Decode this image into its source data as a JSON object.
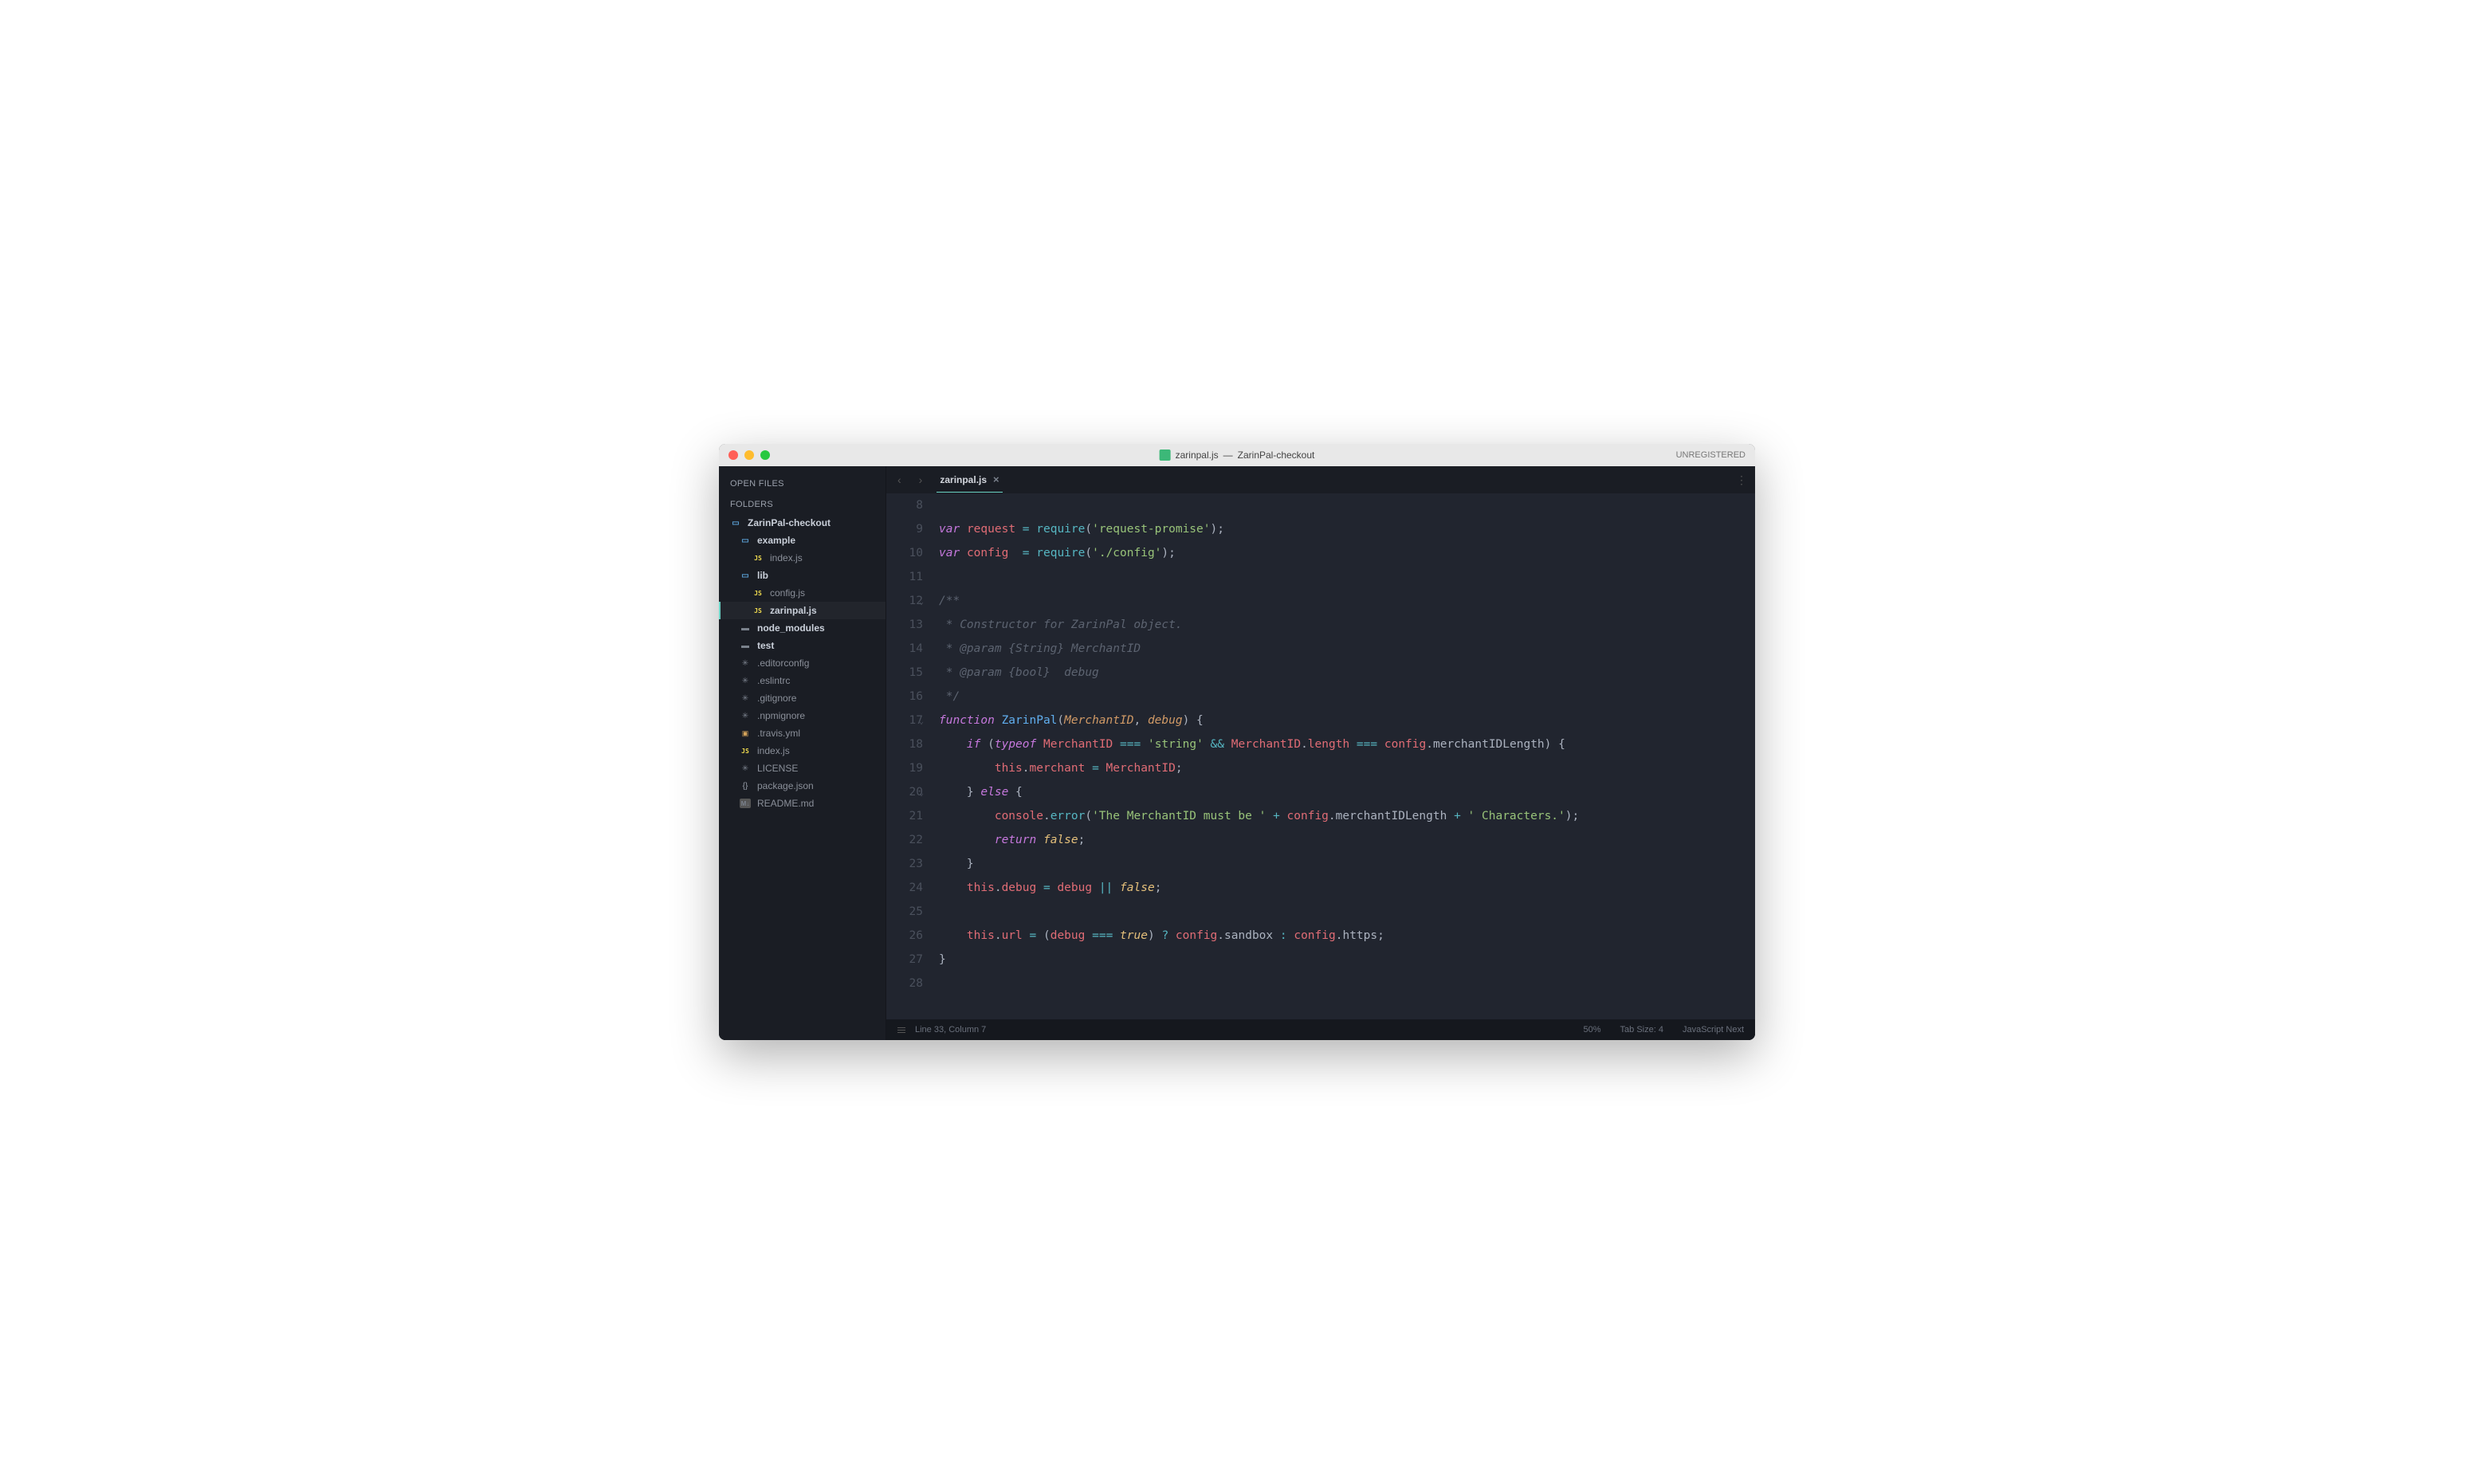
{
  "titlebar": {
    "filename": "zarinpal.js",
    "project": "ZarinPal-checkout",
    "separator": " — ",
    "unregistered": "UNREGISTERED"
  },
  "sidebar": {
    "open_files_label": "OPEN FILES",
    "folders_label": "FOLDERS",
    "tree": [
      {
        "label": "ZarinPal-checkout",
        "icon": "folder-open",
        "indent": 0,
        "bold": true
      },
      {
        "label": "example",
        "icon": "folder-open",
        "indent": 1,
        "bold": true
      },
      {
        "label": "index.js",
        "icon": "js",
        "indent": 2
      },
      {
        "label": "lib",
        "icon": "folder-open",
        "indent": 1,
        "bold": true
      },
      {
        "label": "config.js",
        "icon": "js",
        "indent": 2
      },
      {
        "label": "zarinpal.js",
        "icon": "js",
        "indent": 2,
        "bold": true,
        "active": true
      },
      {
        "label": "node_modules",
        "icon": "folder-closed",
        "indent": 1,
        "bold": true
      },
      {
        "label": "test",
        "icon": "folder-closed",
        "indent": 1,
        "bold": true
      },
      {
        "label": ".editorconfig",
        "icon": "generic",
        "indent": 1
      },
      {
        "label": ".eslintrc",
        "icon": "generic",
        "indent": 1
      },
      {
        "label": ".gitignore",
        "icon": "generic",
        "indent": 1
      },
      {
        "label": ".npmignore",
        "icon": "generic",
        "indent": 1
      },
      {
        "label": ".travis.yml",
        "icon": "yaml",
        "indent": 1
      },
      {
        "label": "index.js",
        "icon": "js",
        "indent": 1
      },
      {
        "label": "LICENSE",
        "icon": "generic",
        "indent": 1
      },
      {
        "label": "package.json",
        "icon": "json",
        "indent": 1
      },
      {
        "label": "README.md",
        "icon": "md",
        "indent": 1
      }
    ]
  },
  "tabs": {
    "active": "zarinpal.js"
  },
  "editor": {
    "first_line": 8,
    "lines": [
      {
        "n": 8,
        "tokens": []
      },
      {
        "n": 9,
        "tokens": [
          [
            "kw",
            "var"
          ],
          [
            "pn",
            " "
          ],
          [
            "nm",
            "request"
          ],
          [
            "pn",
            " "
          ],
          [
            "op",
            "="
          ],
          [
            "pn",
            " "
          ],
          [
            "fn",
            "require"
          ],
          [
            "pn",
            "("
          ],
          [
            "str",
            "'request-promise'"
          ],
          [
            "pn",
            ");"
          ]
        ]
      },
      {
        "n": 10,
        "tokens": [
          [
            "kw",
            "var"
          ],
          [
            "pn",
            " "
          ],
          [
            "nm",
            "config"
          ],
          [
            "pn",
            "  "
          ],
          [
            "op",
            "="
          ],
          [
            "pn",
            " "
          ],
          [
            "fn",
            "require"
          ],
          [
            "pn",
            "("
          ],
          [
            "str",
            "'./config'"
          ],
          [
            "pn",
            ");"
          ]
        ]
      },
      {
        "n": 11,
        "tokens": []
      },
      {
        "n": 12,
        "fold": true,
        "tokens": [
          [
            "cm",
            "/**"
          ]
        ]
      },
      {
        "n": 13,
        "tokens": [
          [
            "cm",
            " * Constructor for ZarinPal object."
          ]
        ]
      },
      {
        "n": 14,
        "tokens": [
          [
            "cm",
            " * @param {String} MerchantID"
          ]
        ]
      },
      {
        "n": 15,
        "tokens": [
          [
            "cm",
            " * @param {bool}  debug"
          ]
        ]
      },
      {
        "n": 16,
        "tokens": [
          [
            "cm",
            " */"
          ]
        ]
      },
      {
        "n": 17,
        "fold": true,
        "tokens": [
          [
            "kw2",
            "function"
          ],
          [
            "pn",
            " "
          ],
          [
            "fn2",
            "ZarinPal"
          ],
          [
            "pn",
            "("
          ],
          [
            "nm2",
            "MerchantID"
          ],
          [
            "pn",
            ", "
          ],
          [
            "nm2",
            "debug"
          ],
          [
            "pn",
            ") {"
          ]
        ]
      },
      {
        "n": 18,
        "tokens": [
          [
            "pn",
            "    "
          ],
          [
            "kw2",
            "if"
          ],
          [
            "pn",
            " ("
          ],
          [
            "kw2",
            "typeof"
          ],
          [
            "pn",
            " "
          ],
          [
            "nm",
            "MerchantID"
          ],
          [
            "pn",
            " "
          ],
          [
            "op",
            "==="
          ],
          [
            "pn",
            " "
          ],
          [
            "str",
            "'string'"
          ],
          [
            "pn",
            " "
          ],
          [
            "op",
            "&&"
          ],
          [
            "pn",
            " "
          ],
          [
            "nm",
            "MerchantID"
          ],
          [
            "pn",
            "."
          ],
          [
            "prop",
            "length"
          ],
          [
            "pn",
            " "
          ],
          [
            "op",
            "==="
          ],
          [
            "pn",
            " "
          ],
          [
            "nm",
            "config"
          ],
          [
            "pn",
            "."
          ],
          [
            "prop2",
            "merchantIDLength"
          ],
          [
            "pn",
            ") {"
          ]
        ]
      },
      {
        "n": 19,
        "tokens": [
          [
            "pn",
            "        "
          ],
          [
            "this",
            "this"
          ],
          [
            "pn",
            "."
          ],
          [
            "prop",
            "merchant"
          ],
          [
            "pn",
            " "
          ],
          [
            "op",
            "="
          ],
          [
            "pn",
            " "
          ],
          [
            "nm",
            "MerchantID"
          ],
          [
            "pn",
            ";"
          ]
        ]
      },
      {
        "n": 20,
        "fold": true,
        "tokens": [
          [
            "pn",
            "    } "
          ],
          [
            "kw2",
            "else"
          ],
          [
            "pn",
            " {"
          ]
        ]
      },
      {
        "n": 21,
        "tokens": [
          [
            "pn",
            "        "
          ],
          [
            "nm",
            "console"
          ],
          [
            "pn",
            "."
          ],
          [
            "fn",
            "error"
          ],
          [
            "pn",
            "("
          ],
          [
            "str",
            "'The MerchantID must be '"
          ],
          [
            "pn",
            " "
          ],
          [
            "op",
            "+"
          ],
          [
            "pn",
            " "
          ],
          [
            "nm",
            "config"
          ],
          [
            "pn",
            "."
          ],
          [
            "prop2",
            "merchantIDLength"
          ],
          [
            "pn",
            " "
          ],
          [
            "op",
            "+"
          ],
          [
            "pn",
            " "
          ],
          [
            "str",
            "' Characters.'"
          ],
          [
            "pn",
            ");"
          ]
        ]
      },
      {
        "n": 22,
        "tokens": [
          [
            "pn",
            "        "
          ],
          [
            "kw2",
            "return"
          ],
          [
            "pn",
            " "
          ],
          [
            "bool",
            "false"
          ],
          [
            "pn",
            ";"
          ]
        ]
      },
      {
        "n": 23,
        "tokens": [
          [
            "pn",
            "    }"
          ]
        ]
      },
      {
        "n": 24,
        "tokens": [
          [
            "pn",
            "    "
          ],
          [
            "this",
            "this"
          ],
          [
            "pn",
            "."
          ],
          [
            "prop",
            "debug"
          ],
          [
            "pn",
            " "
          ],
          [
            "op",
            "="
          ],
          [
            "pn",
            " "
          ],
          [
            "nm",
            "debug"
          ],
          [
            "pn",
            " "
          ],
          [
            "op",
            "||"
          ],
          [
            "pn",
            " "
          ],
          [
            "bool",
            "false"
          ],
          [
            "pn",
            ";"
          ]
        ]
      },
      {
        "n": 25,
        "tokens": []
      },
      {
        "n": 26,
        "tokens": [
          [
            "pn",
            "    "
          ],
          [
            "this",
            "this"
          ],
          [
            "pn",
            "."
          ],
          [
            "prop",
            "url"
          ],
          [
            "pn",
            " "
          ],
          [
            "op",
            "="
          ],
          [
            "pn",
            " ("
          ],
          [
            "nm",
            "debug"
          ],
          [
            "pn",
            " "
          ],
          [
            "op",
            "==="
          ],
          [
            "pn",
            " "
          ],
          [
            "bool",
            "true"
          ],
          [
            "pn",
            ") "
          ],
          [
            "op",
            "?"
          ],
          [
            "pn",
            " "
          ],
          [
            "nm",
            "config"
          ],
          [
            "pn",
            "."
          ],
          [
            "prop2",
            "sandbox"
          ],
          [
            "pn",
            " "
          ],
          [
            "op",
            ":"
          ],
          [
            "pn",
            " "
          ],
          [
            "nm",
            "config"
          ],
          [
            "pn",
            "."
          ],
          [
            "prop2",
            "https"
          ],
          [
            "pn",
            ";"
          ]
        ]
      },
      {
        "n": 27,
        "tokens": [
          [
            "pn",
            "}"
          ]
        ]
      },
      {
        "n": 28,
        "tokens": []
      }
    ]
  },
  "statusbar": {
    "position": "Line 33, Column 7",
    "percent": "50%",
    "tabsize": "Tab Size: 4",
    "syntax": "JavaScript Next"
  }
}
